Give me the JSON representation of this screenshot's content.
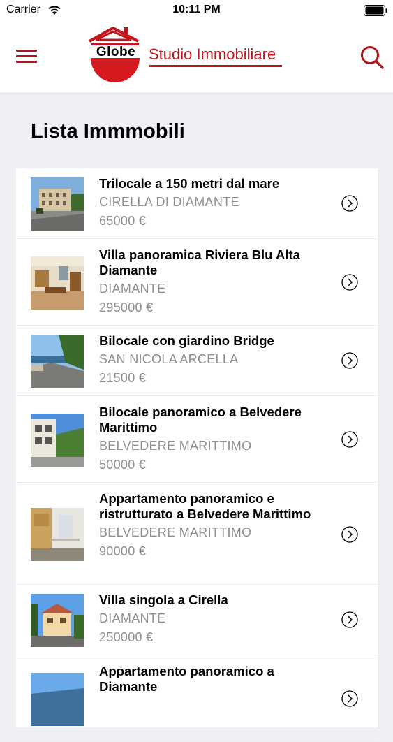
{
  "status_bar": {
    "carrier": "Carrier",
    "time": "10:11 PM",
    "icons": [
      "wifi-icon",
      "battery-icon"
    ]
  },
  "header": {
    "logo_mark_text": "Globe",
    "logo_text": "Studio Immobiliare",
    "icons": [
      "menu-icon",
      "search-icon"
    ],
    "accent_color": "#b1141b"
  },
  "page": {
    "title": "Lista Immmobili"
  },
  "listings": [
    {
      "title": "Trilocale a 150 metri dal mare",
      "location": "CIRELLA DI DIAMANTE",
      "price": "65000 €"
    },
    {
      "title": "Villa panoramica Riviera Blu Alta Diamante",
      "location": "DIAMANTE",
      "price": "295000 €"
    },
    {
      "title": "Bilocale con giardino Bridge",
      "location": "SAN NICOLA ARCELLA",
      "price": "21500 €"
    },
    {
      "title": "Bilocale panoramico a Belvedere Marittimo",
      "location": "BELVEDERE MARITTIMO",
      "price": "50000 €"
    },
    {
      "title": "Appartamento panoramico e ristrutturato a Belvedere Marittimo",
      "location": "BELVEDERE MARITTIMO",
      "price": "90000 €"
    },
    {
      "title": "Villa singola a Cirella",
      "location": "DIAMANTE",
      "price": "250000 €"
    },
    {
      "title": "Appartamento panoramico a Diamante",
      "location": "",
      "price": ""
    }
  ]
}
